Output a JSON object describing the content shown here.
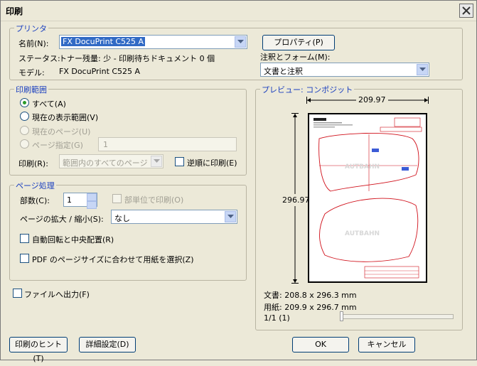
{
  "window": {
    "title": "印刷",
    "close_icon": "close-icon"
  },
  "printer": {
    "group_label": "プリンタ",
    "name_label": "名前(N):",
    "name_value": "FX DocuPrint C525 A",
    "properties_button": "プロパティ(P)",
    "status_label": "ステータス:",
    "status_value": "トナー残量: 少 - 印刷待ちドキュメント 0 個",
    "model_label": "モデル:",
    "model_value": "FX DocuPrint C525 A",
    "comments_label": "注釈とフォーム(M):",
    "comments_value": "文書と注釈"
  },
  "range": {
    "group_label": "印刷範囲",
    "all": "すべて(A)",
    "current_view": "現在の表示範囲(V)",
    "current_page": "現在のページ(U)",
    "pages": "ページ指定(G)",
    "pages_value": "1",
    "subset_label": "印刷(R):",
    "subset_value": "範囲内のすべてのページ",
    "reverse": "逆順に印刷(E)"
  },
  "handling": {
    "group_label": "ページ処理",
    "copies_label": "部数(C):",
    "copies_value": "1",
    "collate": "部単位で印刷(O)",
    "scaling_label": "ページの拡大 / 縮小(S):",
    "scaling_value": "なし",
    "autorotate": "自動回転と中央配置(R)",
    "choose_paper": "PDF のページサイズに合わせて用紙を選択(Z)"
  },
  "print_to_file": "ファイルへ出力(F)",
  "preview": {
    "group_label": "プレビュー: コンポジット",
    "width_dim": "209.97",
    "height_dim": "296.97",
    "doc_size": "文書: 208.8 x 296.3 mm",
    "paper_size": "用紙: 209.9 x 296.7 mm",
    "page_counter": "1/1 (1)",
    "watermark_text": "AUTBAHN",
    "shape_color": "#d0101a",
    "page_position": 0
  },
  "buttons": {
    "hints": "印刷のヒント(T)",
    "advanced": "詳細設定(D)",
    "ok": "OK",
    "cancel": "キャンセル"
  }
}
